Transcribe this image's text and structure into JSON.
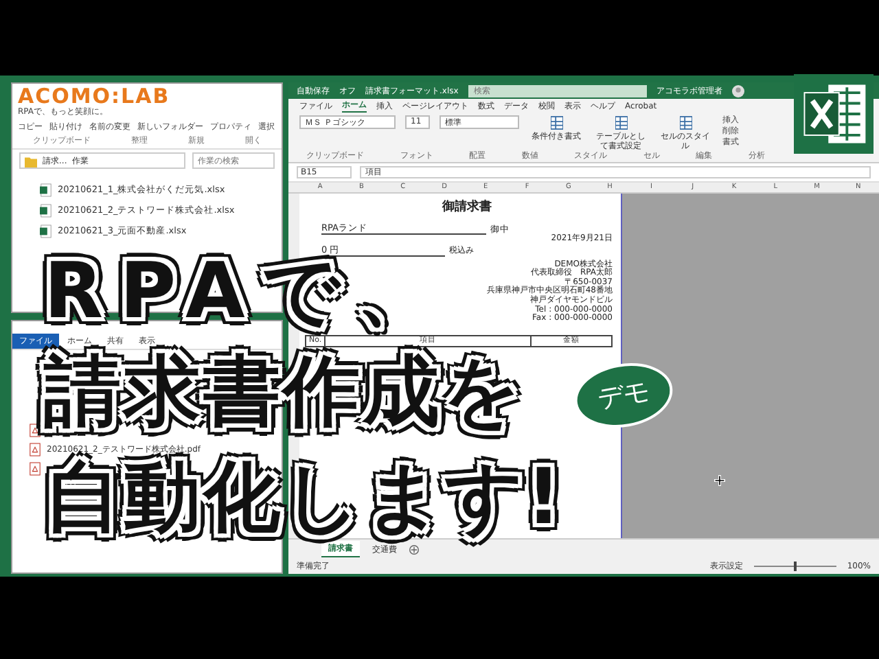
{
  "logo": {
    "title": "ACOMO:LAB",
    "tagline": "RPAで、もっと笑顔に。"
  },
  "explorer_top": {
    "ribbon_buttons": [
      "コピー",
      "貼り付け",
      "名前の変更",
      "新しいフォルダー",
      "プロパティ",
      "選択"
    ],
    "ribbon_groups": [
      "クリップボード",
      "整理",
      "新規",
      "開く"
    ],
    "address": [
      "請求...",
      "作業"
    ],
    "search": {
      "placeholder": "作業の検索"
    },
    "files": [
      "20210621_1_株式会社がくだ元気.xlsx",
      "20210621_2_テストワード株式会社.xlsx",
      "20210621_3_元面不動産.xlsx"
    ]
  },
  "explorer_bottom": {
    "tabs": [
      {
        "label": "ファイル",
        "selected": true
      },
      {
        "label": "ホーム",
        "selected": false
      },
      {
        "label": "共有",
        "selected": false
      },
      {
        "label": "表示",
        "selected": false
      }
    ],
    "files": [
      {
        "kind": "pdf"
      },
      {
        "kind": "pdf",
        "name": "20210621_2_テストワード株式会社.pdf"
      },
      {
        "kind": "pdf"
      }
    ]
  },
  "excel": {
    "title_bar": {
      "autosave": "自動保存",
      "autosave_state": "オフ",
      "file_name": "請求書フォーマット.xlsx",
      "search": {
        "placeholder": "検索"
      },
      "user": "アコモラボ管理者"
    },
    "tabs": [
      {
        "label": "ファイル",
        "selected": false
      },
      {
        "label": "ホーム",
        "selected": true
      },
      {
        "label": "挿入",
        "selected": false
      },
      {
        "label": "ページレイアウト",
        "selected": false
      },
      {
        "label": "数式",
        "selected": false
      },
      {
        "label": "データ",
        "selected": false
      },
      {
        "label": "校閲",
        "selected": false
      },
      {
        "label": "表示",
        "selected": false
      },
      {
        "label": "ヘルプ",
        "selected": false
      },
      {
        "label": "Acrobat",
        "selected": false
      }
    ],
    "font": "ＭＳ Ｐゴシック",
    "font_size": "11",
    "number_format": "標準",
    "style_buttons": [
      "条件付き書式",
      "テーブルとして書式設定",
      "セルのスタイル"
    ],
    "cell_buttons": [
      "挿入",
      "削除",
      "書式"
    ],
    "groups": [
      "クリップボード",
      "フォント",
      "配置",
      "数値",
      "スタイル",
      "セル",
      "編集",
      "分析"
    ],
    "name_box": "B15",
    "formula": "項目",
    "columns": [
      "A",
      "B",
      "C",
      "D",
      "E",
      "F",
      "G",
      "H",
      "I",
      "J",
      "K",
      "L",
      "M",
      "N"
    ],
    "invoice": {
      "title": "御請求書",
      "client": "RPAランド",
      "honorific": "御中",
      "date": "2021年9月21日",
      "amount": "0 円",
      "tax": "税込み",
      "issuer": [
        "DEMO株式会社",
        "代表取締役　RPA太郎",
        "〒650-0037",
        "兵庫県神戸市中央区明石町48番地",
        "神戸ダイヤモンドビル",
        "Tel : 000-000-0000",
        "Fax : 000-000-0000"
      ],
      "headers": [
        "No.",
        "項目",
        "金額"
      ]
    },
    "sheets": [
      {
        "label": "請求書",
        "selected": true
      },
      {
        "label": "交通費",
        "selected": false
      }
    ],
    "status": "準備完了",
    "display_settings": "表示設定",
    "zoom_slider": {
      "level": 0.5
    },
    "zoom": "100%"
  },
  "overlay": {
    "lines": [
      "RPAで、",
      "請求書作成を",
      "自動化します!"
    ],
    "badge": "デモ"
  }
}
